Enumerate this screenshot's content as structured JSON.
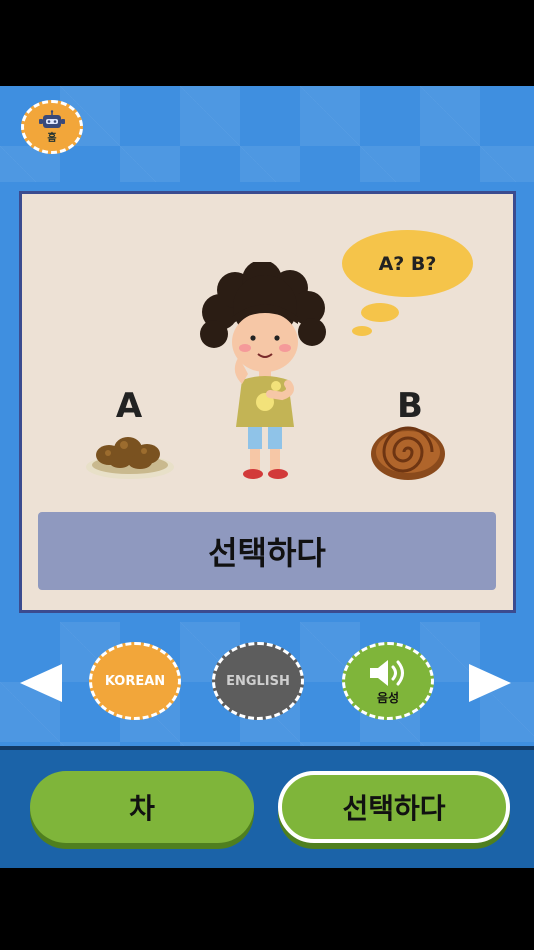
{
  "header": {
    "home_label": "홈"
  },
  "question": {
    "bubble_text": "A? B?",
    "option_a_label": "A",
    "option_b_label": "B",
    "word": "선택하다"
  },
  "language": {
    "korean_label": "KOREAN",
    "english_label": "ENGLISH",
    "voice_label": "음성"
  },
  "answers": [
    {
      "label": "차"
    },
    {
      "label": "선택하다"
    }
  ],
  "colors": {
    "header_blue": "#3f8fe0",
    "card_border": "#3b4b8f",
    "card_bg": "#ede1d5",
    "word_box": "#8f99bf",
    "korean_orange": "#f2a63a",
    "english_gray": "#5d5d5d",
    "voice_green": "#7fb53a",
    "answer_green": "#7fb53a",
    "bubble_yellow": "#f5c44a"
  },
  "icons": {
    "home": "robot-icon",
    "left_arrow": "arrow-left-icon",
    "right_arrow": "arrow-right-icon",
    "voice": "speaker-icon"
  }
}
